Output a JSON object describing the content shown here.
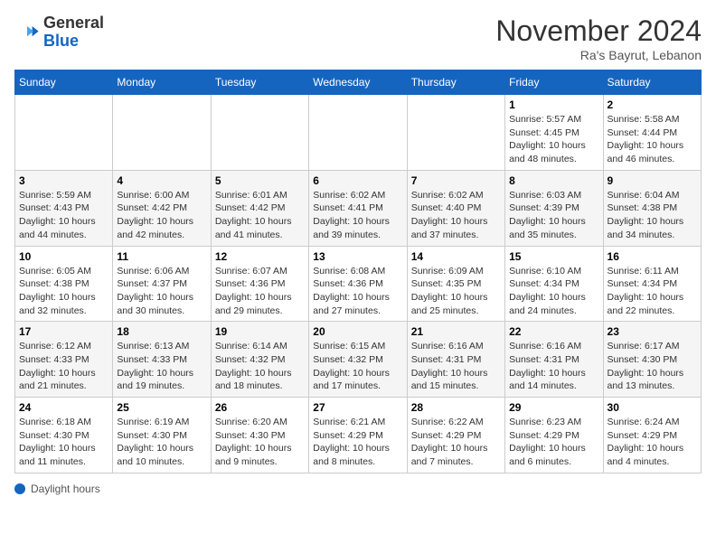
{
  "header": {
    "logo_general": "General",
    "logo_blue": "Blue",
    "month_title": "November 2024",
    "location": "Ra's Bayrut, Lebanon"
  },
  "calendar": {
    "days_of_week": [
      "Sunday",
      "Monday",
      "Tuesday",
      "Wednesday",
      "Thursday",
      "Friday",
      "Saturday"
    ],
    "weeks": [
      [
        {
          "day": "",
          "info": ""
        },
        {
          "day": "",
          "info": ""
        },
        {
          "day": "",
          "info": ""
        },
        {
          "day": "",
          "info": ""
        },
        {
          "day": "",
          "info": ""
        },
        {
          "day": "1",
          "info": "Sunrise: 5:57 AM\nSunset: 4:45 PM\nDaylight: 10 hours\nand 48 minutes."
        },
        {
          "day": "2",
          "info": "Sunrise: 5:58 AM\nSunset: 4:44 PM\nDaylight: 10 hours\nand 46 minutes."
        }
      ],
      [
        {
          "day": "3",
          "info": "Sunrise: 5:59 AM\nSunset: 4:43 PM\nDaylight: 10 hours\nand 44 minutes."
        },
        {
          "day": "4",
          "info": "Sunrise: 6:00 AM\nSunset: 4:42 PM\nDaylight: 10 hours\nand 42 minutes."
        },
        {
          "day": "5",
          "info": "Sunrise: 6:01 AM\nSunset: 4:42 PM\nDaylight: 10 hours\nand 41 minutes."
        },
        {
          "day": "6",
          "info": "Sunrise: 6:02 AM\nSunset: 4:41 PM\nDaylight: 10 hours\nand 39 minutes."
        },
        {
          "day": "7",
          "info": "Sunrise: 6:02 AM\nSunset: 4:40 PM\nDaylight: 10 hours\nand 37 minutes."
        },
        {
          "day": "8",
          "info": "Sunrise: 6:03 AM\nSunset: 4:39 PM\nDaylight: 10 hours\nand 35 minutes."
        },
        {
          "day": "9",
          "info": "Sunrise: 6:04 AM\nSunset: 4:38 PM\nDaylight: 10 hours\nand 34 minutes."
        }
      ],
      [
        {
          "day": "10",
          "info": "Sunrise: 6:05 AM\nSunset: 4:38 PM\nDaylight: 10 hours\nand 32 minutes."
        },
        {
          "day": "11",
          "info": "Sunrise: 6:06 AM\nSunset: 4:37 PM\nDaylight: 10 hours\nand 30 minutes."
        },
        {
          "day": "12",
          "info": "Sunrise: 6:07 AM\nSunset: 4:36 PM\nDaylight: 10 hours\nand 29 minutes."
        },
        {
          "day": "13",
          "info": "Sunrise: 6:08 AM\nSunset: 4:36 PM\nDaylight: 10 hours\nand 27 minutes."
        },
        {
          "day": "14",
          "info": "Sunrise: 6:09 AM\nSunset: 4:35 PM\nDaylight: 10 hours\nand 25 minutes."
        },
        {
          "day": "15",
          "info": "Sunrise: 6:10 AM\nSunset: 4:34 PM\nDaylight: 10 hours\nand 24 minutes."
        },
        {
          "day": "16",
          "info": "Sunrise: 6:11 AM\nSunset: 4:34 PM\nDaylight: 10 hours\nand 22 minutes."
        }
      ],
      [
        {
          "day": "17",
          "info": "Sunrise: 6:12 AM\nSunset: 4:33 PM\nDaylight: 10 hours\nand 21 minutes."
        },
        {
          "day": "18",
          "info": "Sunrise: 6:13 AM\nSunset: 4:33 PM\nDaylight: 10 hours\nand 19 minutes."
        },
        {
          "day": "19",
          "info": "Sunrise: 6:14 AM\nSunset: 4:32 PM\nDaylight: 10 hours\nand 18 minutes."
        },
        {
          "day": "20",
          "info": "Sunrise: 6:15 AM\nSunset: 4:32 PM\nDaylight: 10 hours\nand 17 minutes."
        },
        {
          "day": "21",
          "info": "Sunrise: 6:16 AM\nSunset: 4:31 PM\nDaylight: 10 hours\nand 15 minutes."
        },
        {
          "day": "22",
          "info": "Sunrise: 6:16 AM\nSunset: 4:31 PM\nDaylight: 10 hours\nand 14 minutes."
        },
        {
          "day": "23",
          "info": "Sunrise: 6:17 AM\nSunset: 4:30 PM\nDaylight: 10 hours\nand 13 minutes."
        }
      ],
      [
        {
          "day": "24",
          "info": "Sunrise: 6:18 AM\nSunset: 4:30 PM\nDaylight: 10 hours\nand 11 minutes."
        },
        {
          "day": "25",
          "info": "Sunrise: 6:19 AM\nSunset: 4:30 PM\nDaylight: 10 hours\nand 10 minutes."
        },
        {
          "day": "26",
          "info": "Sunrise: 6:20 AM\nSunset: 4:30 PM\nDaylight: 10 hours\nand 9 minutes."
        },
        {
          "day": "27",
          "info": "Sunrise: 6:21 AM\nSunset: 4:29 PM\nDaylight: 10 hours\nand 8 minutes."
        },
        {
          "day": "28",
          "info": "Sunrise: 6:22 AM\nSunset: 4:29 PM\nDaylight: 10 hours\nand 7 minutes."
        },
        {
          "day": "29",
          "info": "Sunrise: 6:23 AM\nSunset: 4:29 PM\nDaylight: 10 hours\nand 6 minutes."
        },
        {
          "day": "30",
          "info": "Sunrise: 6:24 AM\nSunset: 4:29 PM\nDaylight: 10 hours\nand 4 minutes."
        }
      ]
    ]
  },
  "footer": {
    "label": "Daylight hours"
  }
}
